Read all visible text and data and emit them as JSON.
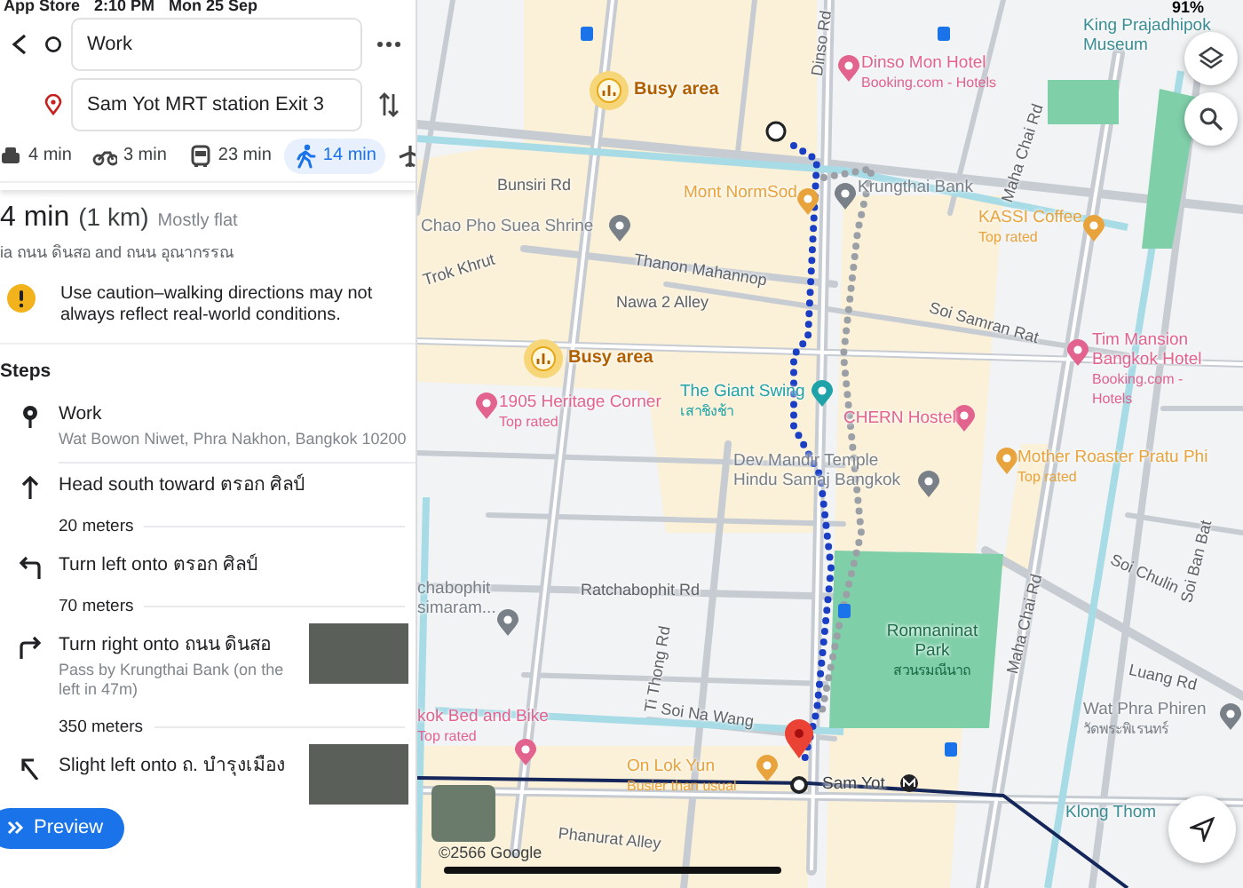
{
  "status_bar": {
    "app": "App Store",
    "time": "2:10 PM",
    "date": "Mon 25 Sep",
    "battery": "91%"
  },
  "route_inputs": {
    "origin": "Work",
    "destination": "Sam Yot MRT station Exit 3"
  },
  "modes": [
    {
      "kind": "car",
      "time": "4 min",
      "selected": false
    },
    {
      "kind": "motorbike",
      "time": "3 min",
      "selected": false
    },
    {
      "kind": "transit",
      "time": "23 min",
      "selected": false
    },
    {
      "kind": "walk",
      "time": "14 min",
      "selected": true
    },
    {
      "kind": "flight",
      "selected": false
    }
  ],
  "summary": {
    "duration": "4 min",
    "distance": "(1 km)",
    "terrain": "Mostly flat",
    "via": "ia ถนน ดินสอ and ถนน อุณากรรณ"
  },
  "warning": "Use caution–walking directions may not always reflect real-world conditions.",
  "steps_heading": "Steps",
  "steps": [
    {
      "kind": "place",
      "title": "Work",
      "detail": "Wat Bowon Niwet, Phra Nakhon, Bangkok 10200"
    },
    {
      "kind": "straight",
      "title": "Head south toward ตรอก ศิลป์",
      "distance": "20 meters"
    },
    {
      "kind": "left",
      "title": "Turn left onto ตรอก ศิลป์",
      "distance": "70 meters"
    },
    {
      "kind": "right",
      "title": "Turn right onto ถนน ดินสอ",
      "detail": "Pass by Krungthai Bank (on the left in 47m)",
      "photo": true,
      "distance": "350 meters"
    },
    {
      "kind": "slight_left",
      "title": "Slight left onto ถ. บำรุงเมือง",
      "photo": true
    }
  ],
  "preview_button": "Preview",
  "map": {
    "labels": [
      {
        "kind": "busy",
        "text": "Busy area"
      },
      {
        "kind": "busy",
        "text": "Busy area"
      },
      {
        "kind": "road",
        "text": "Bunsiri Rd"
      },
      {
        "kind": "poi",
        "text": "Chao Pho Suea Shrine",
        "color": "#7a8088"
      },
      {
        "kind": "road",
        "text": "Trok Khrut"
      },
      {
        "kind": "road",
        "text": "Thanon Mahannop"
      },
      {
        "kind": "road",
        "text": "Nawa 2 Alley"
      },
      {
        "kind": "poi",
        "text": "1905 Heritage Corner",
        "sub": "Top rated",
        "color": "#e3638f"
      },
      {
        "kind": "poi",
        "text": "Mont NormSod",
        "color": "#e8a33d"
      },
      {
        "kind": "poi",
        "text": "Dinso Mon Hotel",
        "sub": "Booking.com - Hotels",
        "color": "#e3638f"
      },
      {
        "kind": "poi",
        "text": "Krungthai Bank",
        "color": "#7a8088"
      },
      {
        "kind": "poi",
        "text": "KASSI Coffee",
        "sub": "Top rated",
        "color": "#e8a33d"
      },
      {
        "kind": "area",
        "text": "King Prajadhipok Museum"
      },
      {
        "kind": "road",
        "text": "Soi Samran Rat"
      },
      {
        "kind": "poi",
        "text": "Tim Mansion Bangkok Hotel",
        "sub": "Booking.com - Hotels",
        "color": "#e3638f"
      },
      {
        "kind": "poi",
        "text": "CHERN Hostel",
        "color": "#e3638f"
      },
      {
        "kind": "poi",
        "text": "The Giant Swing",
        "sub": "เสาชิงช้า",
        "color": "#1fa3a8"
      },
      {
        "kind": "poi",
        "text": "Dev Mandir Temple Hindu Samaj Bangkok",
        "color": "#7a8088"
      },
      {
        "kind": "poi",
        "text": "Mother Roaster Pratu Phi",
        "sub": "Top rated",
        "color": "#e8a33d"
      },
      {
        "kind": "road",
        "text": "Soi Chulin"
      },
      {
        "kind": "road",
        "text": "Soi Ban Bat"
      },
      {
        "kind": "road",
        "text": "Luang Rd"
      },
      {
        "kind": "poi",
        "text": "Wat Phra Phiren",
        "sub": "วัดพระพิเรนทร์",
        "color": "#7a8088"
      },
      {
        "kind": "park",
        "text": "Romnaninat Park",
        "sub": "สวนรมณีนาถ"
      },
      {
        "kind": "area",
        "text": "Klong Thom"
      },
      {
        "kind": "poi",
        "text": "chabophit simaram...",
        "color": "#7a8088"
      },
      {
        "kind": "road",
        "text": "Ratchabophit Rd"
      },
      {
        "kind": "poi",
        "text": "kok Bed and Bike",
        "sub": "Top rated",
        "color": "#e3638f"
      },
      {
        "kind": "poi",
        "text": "On Lok Yun",
        "sub": "Busier than usual",
        "color": "#e8a33d"
      },
      {
        "kind": "road",
        "text": "Soi Na Wang"
      },
      {
        "kind": "road",
        "text": "Ti Thong Rd"
      },
      {
        "kind": "road",
        "text": "Phanurat Alley"
      },
      {
        "kind": "road",
        "text": "Maha Chai Rd"
      },
      {
        "kind": "road",
        "text": "Maha Chai Rd"
      },
      {
        "kind": "road",
        "text": "Dinso Rd"
      },
      {
        "kind": "station",
        "text": "Sam Yot"
      }
    ],
    "copyright": "©2566 Google"
  }
}
